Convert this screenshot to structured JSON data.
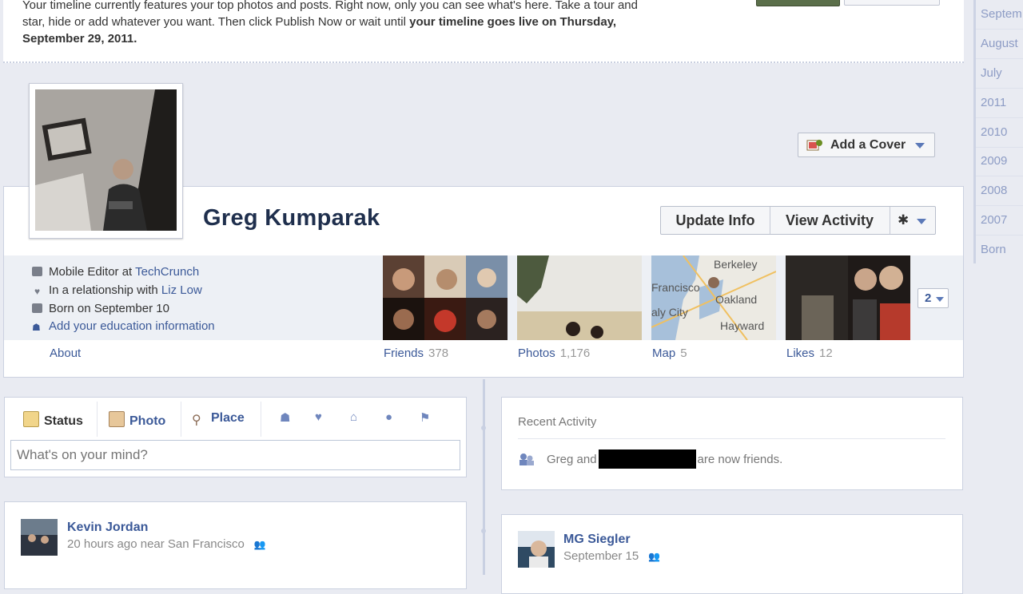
{
  "notice": {
    "line1": "Your timeline currently features your top photos and posts. Right now, only you can see what's here. Take a tour and",
    "line2": "star, hide or add whatever you want. Then click Publish Now or wait until ",
    "line2_bold": "your timeline goes live on Thursday,",
    "line3_bold": "September 29, 2011."
  },
  "timeline_nav": [
    "Septem",
    "August",
    "July",
    "2011",
    "2010",
    "2009",
    "2008",
    "2007",
    "Born"
  ],
  "cover": {
    "add_cover_label": "Add a Cover"
  },
  "profile": {
    "name": "Greg Kumparak",
    "update_info": "Update Info",
    "view_activity": "View Activity"
  },
  "about": {
    "work_prefix": "Mobile Editor at ",
    "work_link": "TechCrunch",
    "relationship_prefix": "In a relationship with ",
    "relationship_link": "Liz Low",
    "born": "Born on September 10",
    "education_link": "Add your education information",
    "label": "About"
  },
  "sections": [
    {
      "label": "Friends",
      "count": "378"
    },
    {
      "label": "Photos",
      "count": "1,176"
    },
    {
      "label": "Map",
      "count": "5"
    },
    {
      "label": "Likes",
      "count": "12"
    }
  ],
  "map_labels": {
    "a": "Berkeley",
    "b": "Francisco",
    "c": "Oakland",
    "d": "aly City",
    "e": "Hayward"
  },
  "more_count": "2",
  "composer": {
    "tabs": [
      "Status",
      "Photo",
      "Place"
    ],
    "placeholder": "What's on your mind?"
  },
  "recent_activity": {
    "title": "Recent Activity",
    "row_prefix": "Greg and",
    "row_suffix": "are now friends."
  },
  "posts": [
    {
      "author": "Kevin Jordan",
      "meta": "20 hours ago near San Francisco"
    },
    {
      "author": "MG Siegler",
      "meta": "September 15"
    }
  ]
}
